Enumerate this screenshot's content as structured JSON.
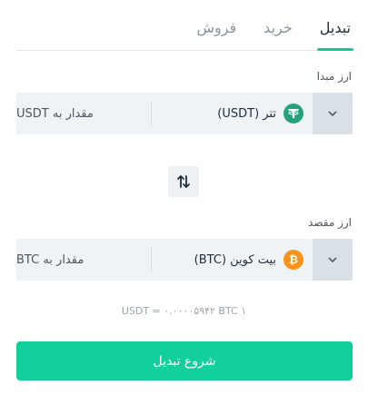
{
  "tabs": [
    {
      "label": "تبدیل",
      "active": true
    },
    {
      "label": "خرید",
      "active": false
    },
    {
      "label": "فروش",
      "active": false
    }
  ],
  "source": {
    "label": "ارز مبدا",
    "currency": "تتر (USDT)",
    "amount_placeholder": "مقدار به USDT",
    "icon": "tether-icon",
    "icon_color": "#26a17b"
  },
  "swap_icon": "swap-arrows-icon",
  "destination": {
    "label": "ارز مقصد",
    "currency": "بیت کوین (BTC)",
    "amount_placeholder": "مقدار به BTC",
    "icon": "bitcoin-icon",
    "icon_color": "#f7931a"
  },
  "rate_text": "۱ USDT = ۰.۰۰۰۰۵۹۴۲ BTC",
  "submit_label": "شروع تبدیل",
  "colors": {
    "accent": "#12cf9c",
    "field_bg": "#f0f3f5",
    "dropdown_bg": "#d9e1e6"
  }
}
